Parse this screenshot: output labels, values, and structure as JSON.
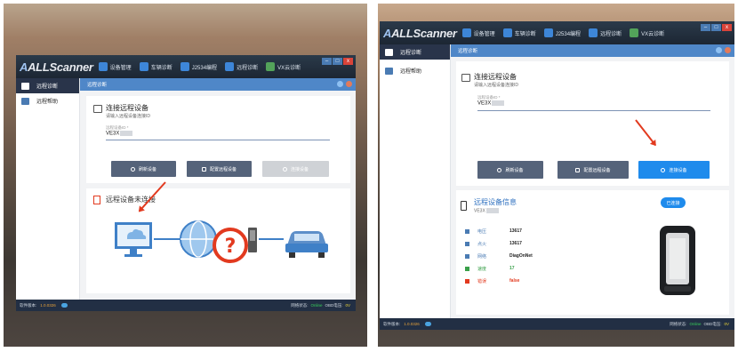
{
  "common": {
    "logo": "ALLScanner",
    "menu": [
      {
        "label": "设备管理",
        "icon": "device-manage-icon"
      },
      {
        "label": "车辆诊断",
        "icon": "vehicle-diag-icon"
      },
      {
        "label": "J2534编程",
        "icon": "j2534-icon"
      },
      {
        "label": "远程诊断",
        "icon": "remote-diag-icon"
      },
      {
        "label": "VX云诊断",
        "icon": "vx-cloud-icon"
      }
    ],
    "window_controls": [
      "–",
      "□",
      "x"
    ],
    "sidebar": [
      "远程诊断",
      "远程帮助"
    ],
    "header": "远程诊断",
    "connect_title": "连接远程设备",
    "connect_sub": "请输入远程设备连接ID",
    "field_label": "远程设备ID *",
    "field_value": "VE3X",
    "btn_refresh": "刷新设备",
    "btn_config": "配置远程设备",
    "btn_connect": "连接设备",
    "footer": {
      "version_label": "软件版本:",
      "version": "1.0.0326",
      "network_label": "网络状态:",
      "network": "Online",
      "obd_label": "OBD电压:",
      "obd": "0V"
    }
  },
  "left": {
    "status_title": "远程设备未连接"
  },
  "right": {
    "info_title": "远程设备信息",
    "info_id": "VE3X",
    "badge": "已连接",
    "info_rows": [
      {
        "label": "电压",
        "value": "13617",
        "style": "normal",
        "icon": "voltage-icon"
      },
      {
        "label": "点火",
        "value": "13617",
        "style": "normal",
        "icon": "ignition-icon"
      },
      {
        "label": "网络",
        "value": "DiagOnNet",
        "style": "normal",
        "icon": "network-icon"
      },
      {
        "label": "速度",
        "value": "17",
        "style": "grn",
        "icon": "wifi-icon"
      },
      {
        "label": "错误",
        "value": "false",
        "style": "red",
        "icon": "error-icon"
      }
    ]
  },
  "colors": {
    "accent": "#1f8bec",
    "header": "#4f87c8",
    "sidebar_active": "#29344a",
    "arrow": "#e23a1f",
    "online": "#37d05a"
  }
}
